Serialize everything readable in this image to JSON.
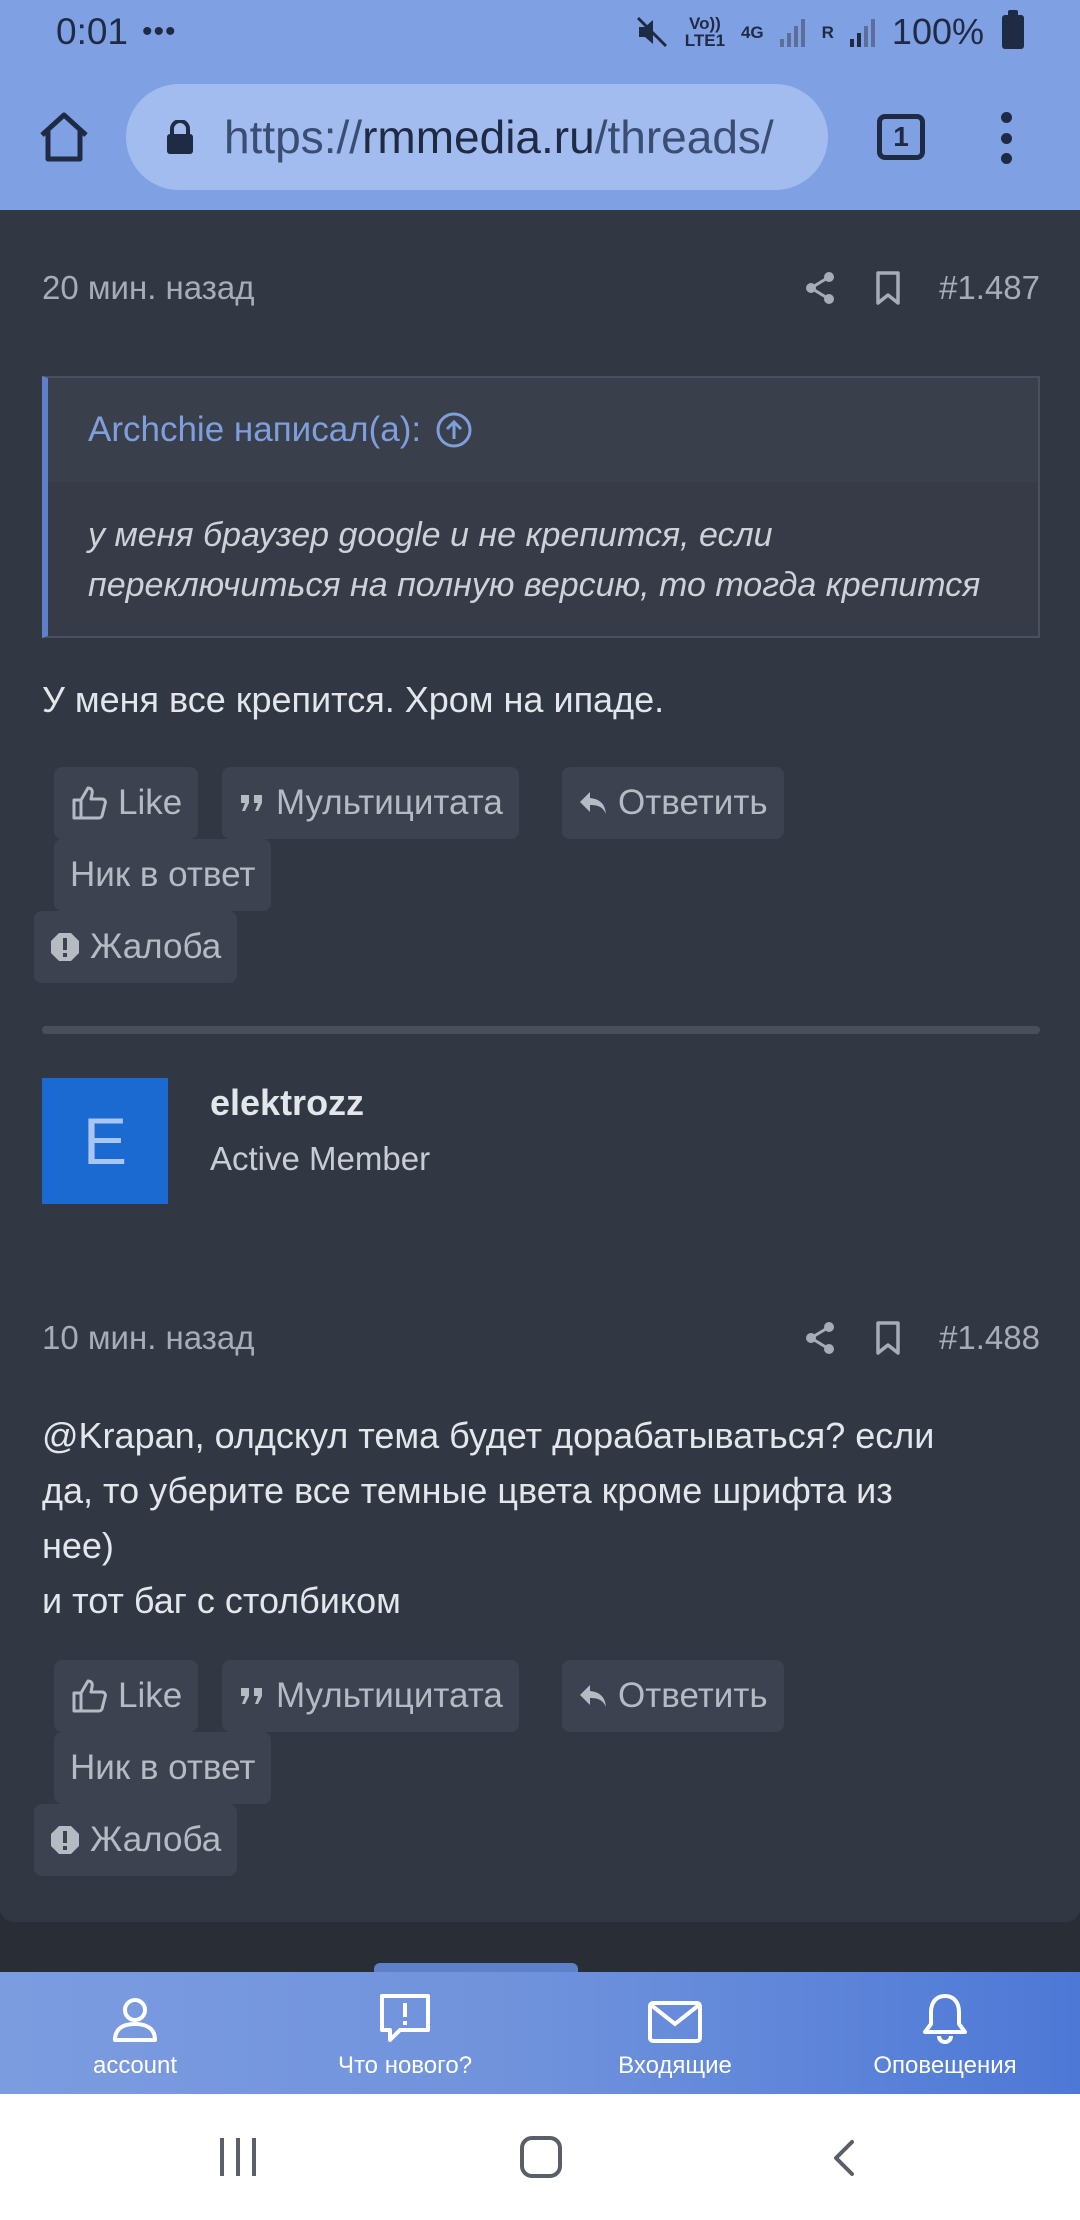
{
  "status_bar": {
    "time": "0:01",
    "dots": "•••",
    "network_top": "Vo)) LTE1",
    "network_4g": "4G",
    "network_r": "R",
    "battery": "100%"
  },
  "browser": {
    "url_prefix": "https://",
    "url_domain": "rmmedia.ru",
    "url_path": "/threads/",
    "tab_count": "1"
  },
  "posts": [
    {
      "time": "20 мин. назад",
      "number": "#1.487",
      "quote": {
        "author": "Archchie написал(а):",
        "lines": [
          "у меня браузер google и не крепится, если",
          "переключиться на полную версию, то тогда крепится"
        ]
      },
      "text": [
        "У меня все крепится. Хром на ипаде."
      ],
      "actions": {
        "like": "Like",
        "multiquote": "Мультицитата",
        "reply": "Ответить",
        "nick": "Ник в ответ",
        "report": "Жалоба"
      }
    },
    {
      "author": {
        "initial": "E",
        "name": "elektrozz",
        "title": "Active Member"
      },
      "time": "10 мин. назад",
      "number": "#1.488",
      "text": [
        "@Krapan, олдскул тема будет дорабатываться? если",
        "да, то уберите все темные цвета кроме шрифта из",
        "нее)",
        "и тот баг с столбиком"
      ],
      "actions": {
        "like": "Like",
        "multiquote": "Мультицитата",
        "reply": "Ответить",
        "nick": "Ник в ответ",
        "report": "Жалоба"
      }
    }
  ],
  "bottom_nav": [
    {
      "label": "account",
      "icon": "account-icon"
    },
    {
      "label": "Что нового?",
      "icon": "whats-new-icon"
    },
    {
      "label": "Входящие",
      "icon": "inbox-icon"
    },
    {
      "label": "Оповещения",
      "icon": "bell-icon"
    }
  ],
  "colors": {
    "accent": "#7fa0e2",
    "background": "#292d36",
    "card": "#323744",
    "avatar": "#1b6ad2",
    "quote_link": "#7f9fdc"
  }
}
